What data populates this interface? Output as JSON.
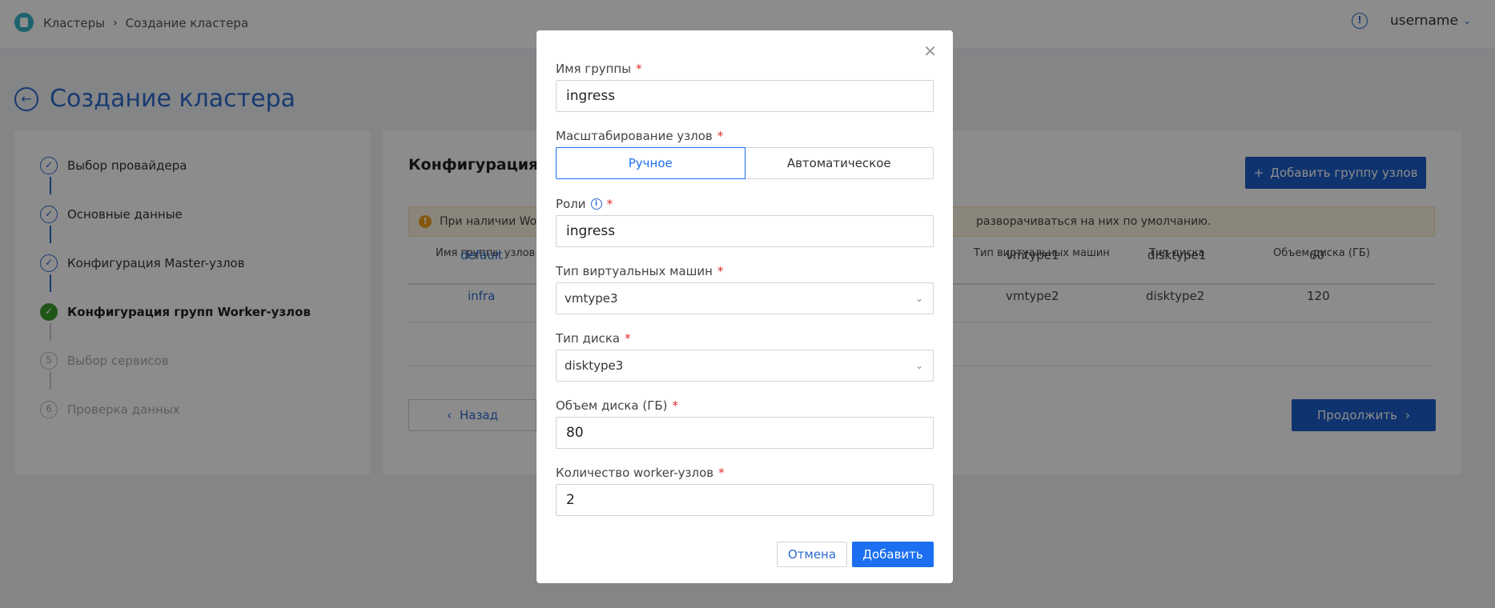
{
  "header": {
    "breadcrumb": [
      "Кластеры",
      "Создание кластера"
    ],
    "breadcrumb_sep": "›",
    "info_icon": "!",
    "username": "username",
    "chevron": "⌄"
  },
  "page": {
    "title": "Создание кластера",
    "back_icon": "←"
  },
  "steps": [
    {
      "num": "✓",
      "label": "Выбор провайдера",
      "state": "done"
    },
    {
      "num": "✓",
      "label": "Основные данные",
      "state": "done"
    },
    {
      "num": "✓",
      "label": "Конфигурация Master-узлов",
      "state": "done"
    },
    {
      "num": "✓",
      "label": "Конфигурация групп Worker-узлов",
      "state": "active"
    },
    {
      "num": "5",
      "label": "Выбор сервисов",
      "state": "future"
    },
    {
      "num": "6",
      "label": "Проверка данных",
      "state": "future"
    }
  ],
  "main": {
    "title": "Конфигурация гр",
    "add_group_button": "Добавить группу узлов",
    "add_icon": "+",
    "alert_warn_icon": "!",
    "alert_text_left": "При наличии Wo",
    "alert_text_right": "разворачиваться на них по умолчанию.",
    "columns": {
      "name": "Имя группы узлов",
      "vm_type": "Тип виртуальных машин",
      "disk_type": "Тип диска",
      "disk_size": "Объем диска (ГБ)"
    },
    "rows": [
      {
        "name": "default",
        "vm_type": "vmtype1",
        "disk_type": "disktype1",
        "disk_size": "60"
      },
      {
        "name": "infra",
        "vm_type": "vmtype2",
        "disk_type": "disktype2",
        "disk_size": "120"
      }
    ],
    "back_button": "Назад",
    "back_icon": "‹",
    "continue_button": "Продолжить",
    "continue_icon": "›"
  },
  "modal": {
    "close_icon": "✕",
    "required_mark": "*",
    "group_name": {
      "label": "Имя группы",
      "value": "ingress"
    },
    "scaling": {
      "label": "Масштабирование узлов",
      "options": [
        "Ручное",
        "Автоматическое"
      ],
      "selected": "Ручное"
    },
    "roles": {
      "label": "Роли",
      "info_icon": "i",
      "value": "ingress"
    },
    "vm_type": {
      "label": "Тип виртуальных машин",
      "value": "vmtype3"
    },
    "disk_type": {
      "label": "Тип диска",
      "value": "disktype3"
    },
    "disk_size": {
      "label": "Объем диска (ГБ)",
      "value": "80"
    },
    "worker_count": {
      "label": "Количество worker-узлов",
      "value": "2"
    },
    "select_chevron": "⌄",
    "cancel_button": "Отмена",
    "add_button": "Добавить"
  }
}
